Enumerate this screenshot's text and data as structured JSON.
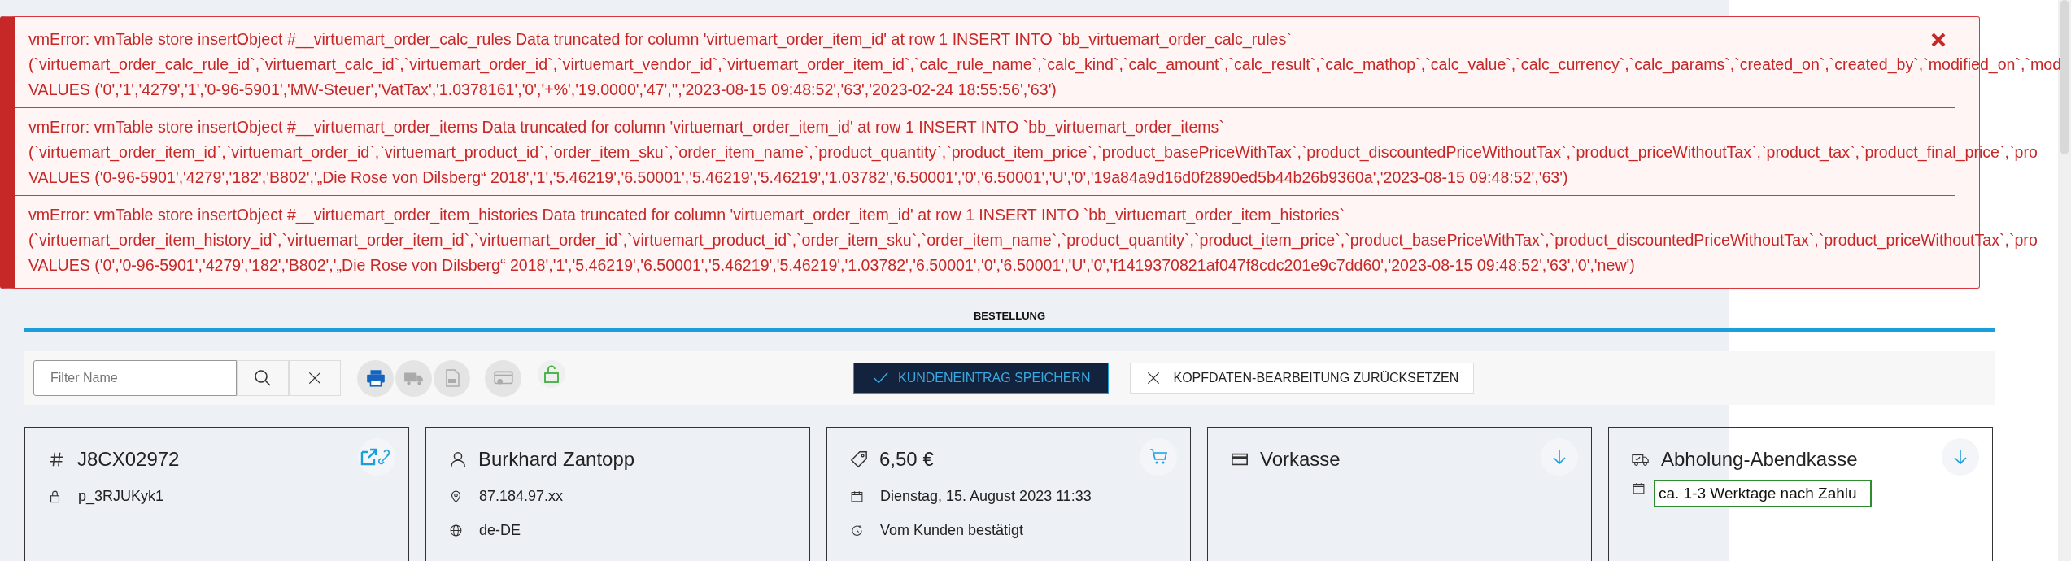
{
  "errors": [
    {
      "lines": [
        "vmError: vmTable store insertObject #__virtuemart_order_calc_rules Data truncated for column 'virtuemart_order_item_id' at row 1 INSERT INTO `bb_virtuemart_order_calc_rules`",
        "(`virtuemart_order_calc_rule_id`,`virtuemart_calc_id`,`virtuemart_order_id`,`virtuemart_vendor_id`,`virtuemart_order_item_id`,`calc_rule_name`,`calc_kind`,`calc_amount`,`calc_result`,`calc_mathop`,`calc_value`,`calc_currency`,`calc_params`,`created_on`,`created_by`,`modified_on`,`mod",
        "VALUES ('0','1','4279','1','0-96-5901','MW-Steuer','VatTax','1.0378161','0','+%','19.0000','47','','2023-08-15 09:48:52','63','2023-02-24 18:55:56','63')"
      ]
    },
    {
      "lines": [
        "vmError: vmTable store insertObject #__virtuemart_order_items Data truncated for column 'virtuemart_order_item_id' at row 1 INSERT INTO `bb_virtuemart_order_items`",
        "(`virtuemart_order_item_id`,`virtuemart_order_id`,`virtuemart_product_id`,`order_item_sku`,`order_item_name`,`product_quantity`,`product_item_price`,`product_basePriceWithTax`,`product_discountedPriceWithoutTax`,`product_priceWithoutTax`,`product_tax`,`product_final_price`,`pro",
        "VALUES ('0-96-5901','4279','182','B802','„Die Rose von Dilsberg“ 2018','1','5.46219','6.50001','5.46219','5.46219','1.03782','6.50001','0','6.50001','U','0','19a84a9d16d0f2890ed5b44b26b9360a','2023-08-15 09:48:52','63')"
      ]
    },
    {
      "lines": [
        "vmError: vmTable store insertObject #__virtuemart_order_item_histories Data truncated for column 'virtuemart_order_item_id' at row 1 INSERT INTO `bb_virtuemart_order_item_histories`",
        "(`virtuemart_order_item_history_id`,`virtuemart_order_item_id`,`virtuemart_order_id`,`virtuemart_product_id`,`order_item_sku`,`order_item_name`,`product_quantity`,`product_item_price`,`product_basePriceWithTax`,`product_discountedPriceWithoutTax`,`product_priceWithoutTax`,`pro",
        "VALUES ('0','0-96-5901','4279','182','B802','„Die Rose von Dilsberg“ 2018','1','5.46219','6.50001','5.46219','5.46219','1.03782','6.50001','0','6.50001','U','0','f1419370821af047f8cdc201e9c7dd60','2023-08-15 09:48:52','63','0','new')"
      ]
    }
  ],
  "section_tab": {
    "label": "BESTELLUNG",
    "selected": true
  },
  "toolbar": {
    "filter": {
      "placeholder": "Filter Name"
    },
    "icon_buttons": [
      {
        "kind": "print",
        "disabled": false
      },
      {
        "kind": "truck",
        "disabled": true
      },
      {
        "kind": "pdf",
        "disabled": true
      },
      {
        "kind": "card",
        "disabled": true
      },
      {
        "kind": "lock",
        "disabled": false
      }
    ],
    "save_button": "KUNDENEINTRAG SPEICHERN",
    "reset_button": "KOPFDATEN-BEARBEITUNG ZURÜCKSETZEN"
  },
  "cards": [
    {
      "kind": "order",
      "title": "J8CX02972",
      "rows": [
        {
          "kind": "lock",
          "text": "p_3RJUKyk1"
        }
      ]
    },
    {
      "kind": "customer",
      "title": "Burkhard Zantopp",
      "rows": [
        {
          "kind": "pin",
          "text": "87.184.97.xx"
        },
        {
          "kind": "globe",
          "text": "de-DE"
        }
      ]
    },
    {
      "kind": "price",
      "title": "6,50 €",
      "rows": [
        {
          "kind": "calendar",
          "text": "Dienstag, 15. August 2023 11:33"
        },
        {
          "kind": "clock",
          "text": "Vom Kunden bestätigt"
        }
      ]
    },
    {
      "kind": "payment",
      "title": "Vorkasse"
    },
    {
      "kind": "shipping",
      "title": "Abholung-Abendkasse",
      "rows": [
        {
          "kind": "field",
          "text": "ca. 1-3 Werktage nach Zahlu"
        }
      ]
    }
  ]
}
